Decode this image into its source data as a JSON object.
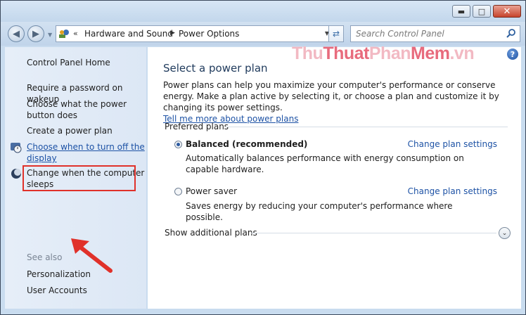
{
  "window": {
    "buttons": {
      "minimize": "▬",
      "maximize": "□",
      "close": "✕"
    }
  },
  "navbar": {
    "back_icon": "back-arrow-icon",
    "forward_icon": "forward-arrow-icon",
    "address": {
      "chevron": "«",
      "crumbs": [
        "Hardware and Sound",
        "Power Options"
      ],
      "separator": "▶"
    },
    "search_placeholder": "Search Control Panel"
  },
  "sidebar": {
    "home": "Control Panel Home",
    "items": [
      {
        "label": "Require a password on wakeup"
      },
      {
        "label": "Choose what the power button does"
      },
      {
        "label": "Create a power plan"
      },
      {
        "label": "Choose when to turn off the display"
      },
      {
        "label": "Change when the computer sleeps"
      }
    ],
    "see_also": "See also",
    "see_also_items": [
      "Personalization",
      "User Accounts"
    ]
  },
  "watermark": {
    "parts": [
      "Thu",
      "Thuat",
      "Phan",
      "Mem",
      ".vn"
    ]
  },
  "main": {
    "title": "Select a power plan",
    "description": "Power plans can help you maximize your computer's performance or conserve energy. Make a plan active by selecting it, or choose a plan and customize it by changing its power settings.",
    "learn_more": "Tell me more about power plans",
    "preferred_plans": "Preferred plans",
    "plans": [
      {
        "name": "Balanced (recommended)",
        "selected": true,
        "link": "Change plan settings",
        "description": "Automatically balances performance with energy consumption on capable hardware."
      },
      {
        "name": "Power saver",
        "selected": false,
        "link": "Change plan settings",
        "description": "Saves energy by reducing your computer's performance where possible."
      }
    ],
    "show_additional": "Show additional plans"
  },
  "colors": {
    "link": "#1d52a5",
    "highlight": "#e0312a",
    "watermark_pink": "#f2b9c3",
    "watermark_red": "#e86b7d"
  }
}
